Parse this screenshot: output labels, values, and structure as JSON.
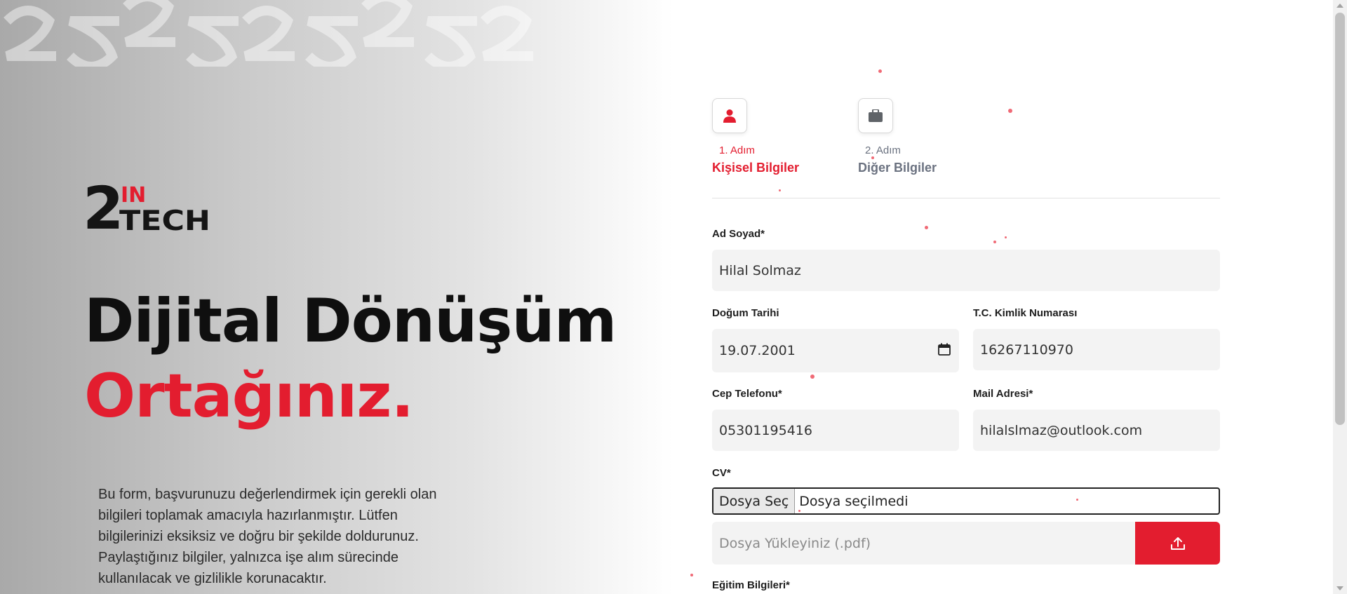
{
  "brand": {
    "logo_number": "2",
    "logo_mark": "IN",
    "logo_word": "TECH"
  },
  "hero": {
    "line1": "Dijital Dönüşüm",
    "line2": "Ortağınız.",
    "description": "Bu form, başvurunuzu değerlendirmek için gerekli olan bilgileri toplamak amacıyla hazırlanmıştır. Lütfen bilgilerinizi eksiksiz ve doğru bir şekilde doldurunuz. Paylaştığınız bilgiler, yalnızca işe alım sürecinde kullanılacak ve gizlilikle korunacaktır."
  },
  "steps": [
    {
      "step": "1. Adım",
      "title": "Kişisel Bilgiler",
      "icon": "user-icon",
      "active": true
    },
    {
      "step": "2. Adım",
      "title": "Diğer Bilgiler",
      "icon": "briefcase-icon",
      "active": false
    }
  ],
  "form": {
    "full_name": {
      "label": "Ad Soyad*",
      "value": "Hilal Solmaz"
    },
    "birth_date": {
      "label": "Doğum Tarihi",
      "value": "19.07.2001"
    },
    "tc_no": {
      "label": "T.C. Kimlik Numarası",
      "value": "16267110970"
    },
    "phone": {
      "label": "Cep Telefonu*",
      "value": "05301195416"
    },
    "email": {
      "label": "Mail Adresi*",
      "value": "hilalslmaz@outlook.com"
    },
    "cv": {
      "label": "CV*",
      "choose_button": "Dosya Seç",
      "status": "Dosya seçilmedi",
      "upload_placeholder": "Dosya Yükleyiniz (.pdf)"
    },
    "education": {
      "label": "Eğitim Bilgileri*"
    }
  },
  "colors": {
    "accent": "#e31d2f",
    "text_dark": "#0f0f0f",
    "inactive_step": "#6b7280",
    "field_bg": "#f3f3f3"
  }
}
